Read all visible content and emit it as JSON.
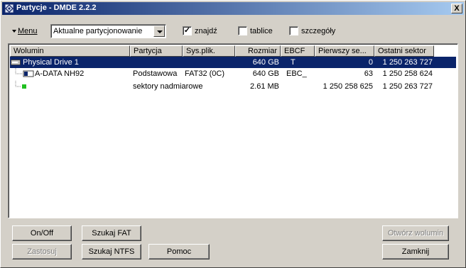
{
  "window": {
    "title": "Partycje - DMDE 2.2.2",
    "close_label": "X"
  },
  "toolbar": {
    "menu_label": "Menu",
    "combo_value": "Aktualne partycjonowanie",
    "find_label": "znajdź",
    "find_checked": true,
    "tables_label": "tablice",
    "tables_checked": false,
    "details_label": "szczegóły",
    "details_checked": false
  },
  "columns": [
    "Wolumin",
    "Partycja",
    "Sys.plik.",
    "Rozmiar",
    "EBCF",
    "Pierwszy se...",
    "Ostatni sektor"
  ],
  "rows": [
    {
      "volume": "Physical Drive 1",
      "partition": "",
      "fs": "",
      "size": "640 GB",
      "ebcf": "T",
      "first": "0",
      "last": "1 250 263 727",
      "selected": true
    },
    {
      "volume": "A-DATA NH92",
      "partition": "Podstawowa",
      "fs": "FAT32 (0C)",
      "size": "640 GB",
      "ebcf": "EBC_",
      "first": "63",
      "last": "1 250 258 624",
      "selected": false
    },
    {
      "volume": "",
      "partition": "sektory nadmiarowe",
      "fs": "",
      "size": "2.61 MB",
      "ebcf": "",
      "first": "1 250 258 625",
      "last": "1 250 263 727",
      "selected": false
    }
  ],
  "buttons": {
    "onoff": "On/Off",
    "search_fat": "Szukaj FAT",
    "open_volume": "Otwórz wolumin",
    "apply": "Zastosuj",
    "search_ntfs": "Szukaj NTFS",
    "help": "Pomoc",
    "close": "Zamknij"
  }
}
